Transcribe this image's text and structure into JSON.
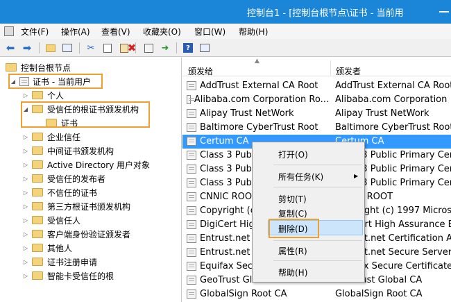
{
  "window": {
    "title": "控制台1 - [控制台根节点\\证书 - 当前用"
  },
  "menu": [
    "文件(F)",
    "操作(A)",
    "查看(V)",
    "收藏夹(O)",
    "窗口(W)",
    "帮助(H)"
  ],
  "tree": {
    "root": "控制台根节点",
    "store": "证书 - 当前用户",
    "items": [
      {
        "label": "个人",
        "arrow": "▷",
        "level": 2
      },
      {
        "label": "受信任的根证书颁发机构",
        "arrow": "◢",
        "level": 2
      },
      {
        "label": "证书",
        "arrow": "",
        "level": 3
      },
      {
        "label": "企业信任",
        "arrow": "▷",
        "level": 2
      },
      {
        "label": "中间证书颁发机构",
        "arrow": "▷",
        "level": 2
      },
      {
        "label": "Active Directory 用户对象",
        "arrow": "▷",
        "level": 2
      },
      {
        "label": "受信任的发布者",
        "arrow": "▷",
        "level": 2
      },
      {
        "label": "不信任的证书",
        "arrow": "▷",
        "level": 2
      },
      {
        "label": "第三方根证书颁发机构",
        "arrow": "▷",
        "level": 2
      },
      {
        "label": "受信任人",
        "arrow": "▷",
        "level": 2
      },
      {
        "label": "客户端身份验证颁发者",
        "arrow": "▷",
        "level": 2
      },
      {
        "label": "其他人",
        "arrow": "▷",
        "level": 2
      },
      {
        "label": "证书注册申请",
        "arrow": "▷",
        "level": 2
      },
      {
        "label": "智能卡受信任的根",
        "arrow": "▷",
        "level": 2
      }
    ]
  },
  "list": {
    "col_issued_to": "颁发给",
    "col_issued_by": "颁发者",
    "rows": [
      {
        "to": "AddTrust External CA Root",
        "by": "AddTrust External CA Root"
      },
      {
        "to": "Alibaba.com Corporation Ro...",
        "by": "Alibaba.com Corporation"
      },
      {
        "to": "Alipay Trust NetWork",
        "by": "Alipay Trust NetWork"
      },
      {
        "to": "Baltimore CyberTrust Root",
        "by": "Baltimore CyberTrust Root"
      },
      {
        "to": "Certum CA",
        "by": "Certum CA"
      },
      {
        "to": "Class 3 Publ",
        "by": "Class 3 Public Primary Cert"
      },
      {
        "to": "Class 3 Publ",
        "by": "Class 3 Public Primary Cert"
      },
      {
        "to": "Class 3 Publ",
        "by": "Class 3 Public Primary Cert"
      },
      {
        "to": "CNNIC ROOT",
        "by": "CNNIC ROOT"
      },
      {
        "to": "Copyright (c",
        "by": "Copyright (c) 1997 Microso"
      },
      {
        "to": "DigiCert Hig",
        "by": "DigiCert High Assurance EV"
      },
      {
        "to": "Entrust.net",
        "by": "Entrust.net Certification Au"
      },
      {
        "to": "Entrust.net S",
        "by": "Entrust.net Secure Server C"
      },
      {
        "to": "Equifax Secu",
        "by": "Equifax Secure Certificate A"
      },
      {
        "to": "GeoTrust Global CA",
        "by": "GeoTrust Global CA"
      },
      {
        "to": "GlobalSign Root CA",
        "by": "GlobalSign Root CA"
      }
    ]
  },
  "context_menu": {
    "open": "打开(O)",
    "all_tasks": "所有任务(K)",
    "cut": "剪切(T)",
    "copy": "复制(C)",
    "delete": "删除(D)",
    "properties": "属性(R)",
    "help": "帮助(H)"
  },
  "colors": {
    "titlebar": "#1b86d8",
    "selection": "#3399ff",
    "highlight_box": "#f0a030",
    "menu_hover": "#cce5fb"
  }
}
